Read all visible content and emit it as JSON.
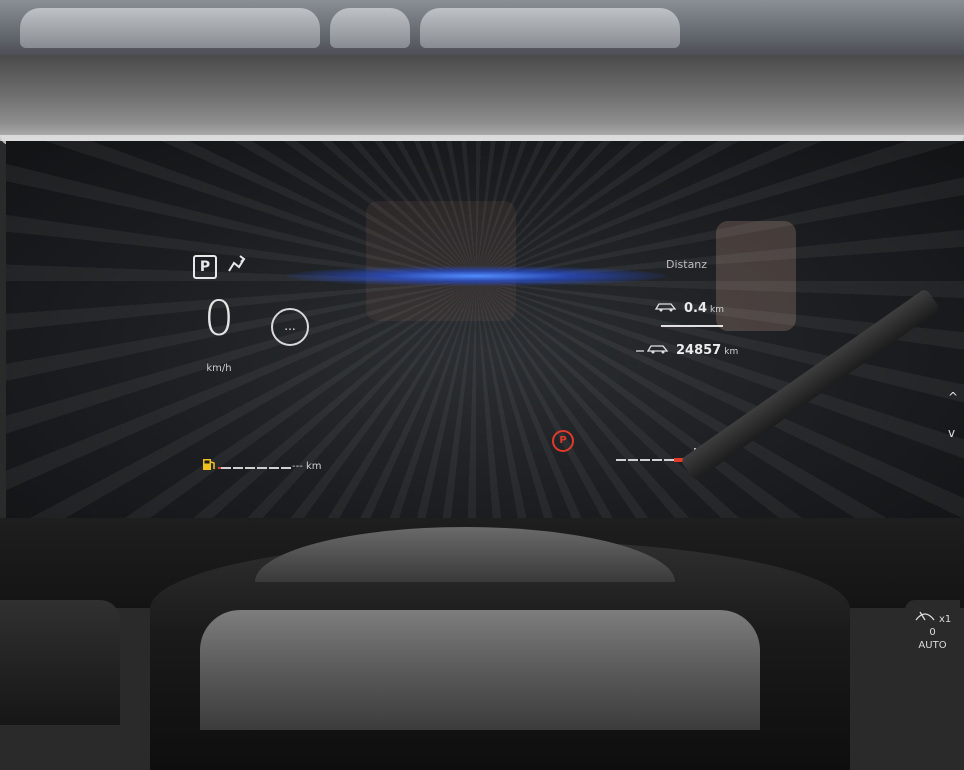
{
  "cluster": {
    "gear": "P",
    "speed": "0",
    "speed_unit": "km/h",
    "more_label": "...",
    "trip_title": "Distanz",
    "trip_value": "0.4",
    "trip_unit": "km",
    "odometer_value": "24857",
    "odometer_unit": "km",
    "range_value": "---",
    "range_unit": "km",
    "park_brake_label": "P"
  },
  "wiper": {
    "multiplier": "x1",
    "level": "0",
    "mode": "AUTO"
  },
  "colors": {
    "warning": "#e03a2a",
    "glare": "#3a6bff"
  }
}
